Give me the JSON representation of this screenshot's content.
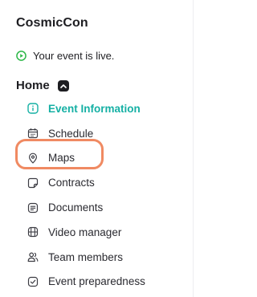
{
  "app": {
    "title": "CosmicCon"
  },
  "status": {
    "text": "Your event is live.",
    "color": "#2fb84a",
    "icon": "play-circle-icon"
  },
  "section": {
    "title": "Home",
    "toggle_icon": "chevron-up-icon"
  },
  "nav": {
    "items": [
      {
        "label": "Event Information",
        "icon": "info-icon",
        "active": true
      },
      {
        "label": "Schedule",
        "icon": "calendar-icon"
      },
      {
        "label": "Maps",
        "icon": "map-pin-icon",
        "highlighted": true
      },
      {
        "label": "Contracts",
        "icon": "contract-icon"
      },
      {
        "label": "Documents",
        "icon": "document-icon"
      },
      {
        "label": "Video manager",
        "icon": "video-icon"
      },
      {
        "label": "Team members",
        "icon": "team-icon"
      },
      {
        "label": "Event preparedness",
        "icon": "checklist-icon"
      }
    ]
  },
  "colors": {
    "accent": "#15b0a4",
    "highlight": "#f08a62",
    "live": "#2fb84a"
  }
}
